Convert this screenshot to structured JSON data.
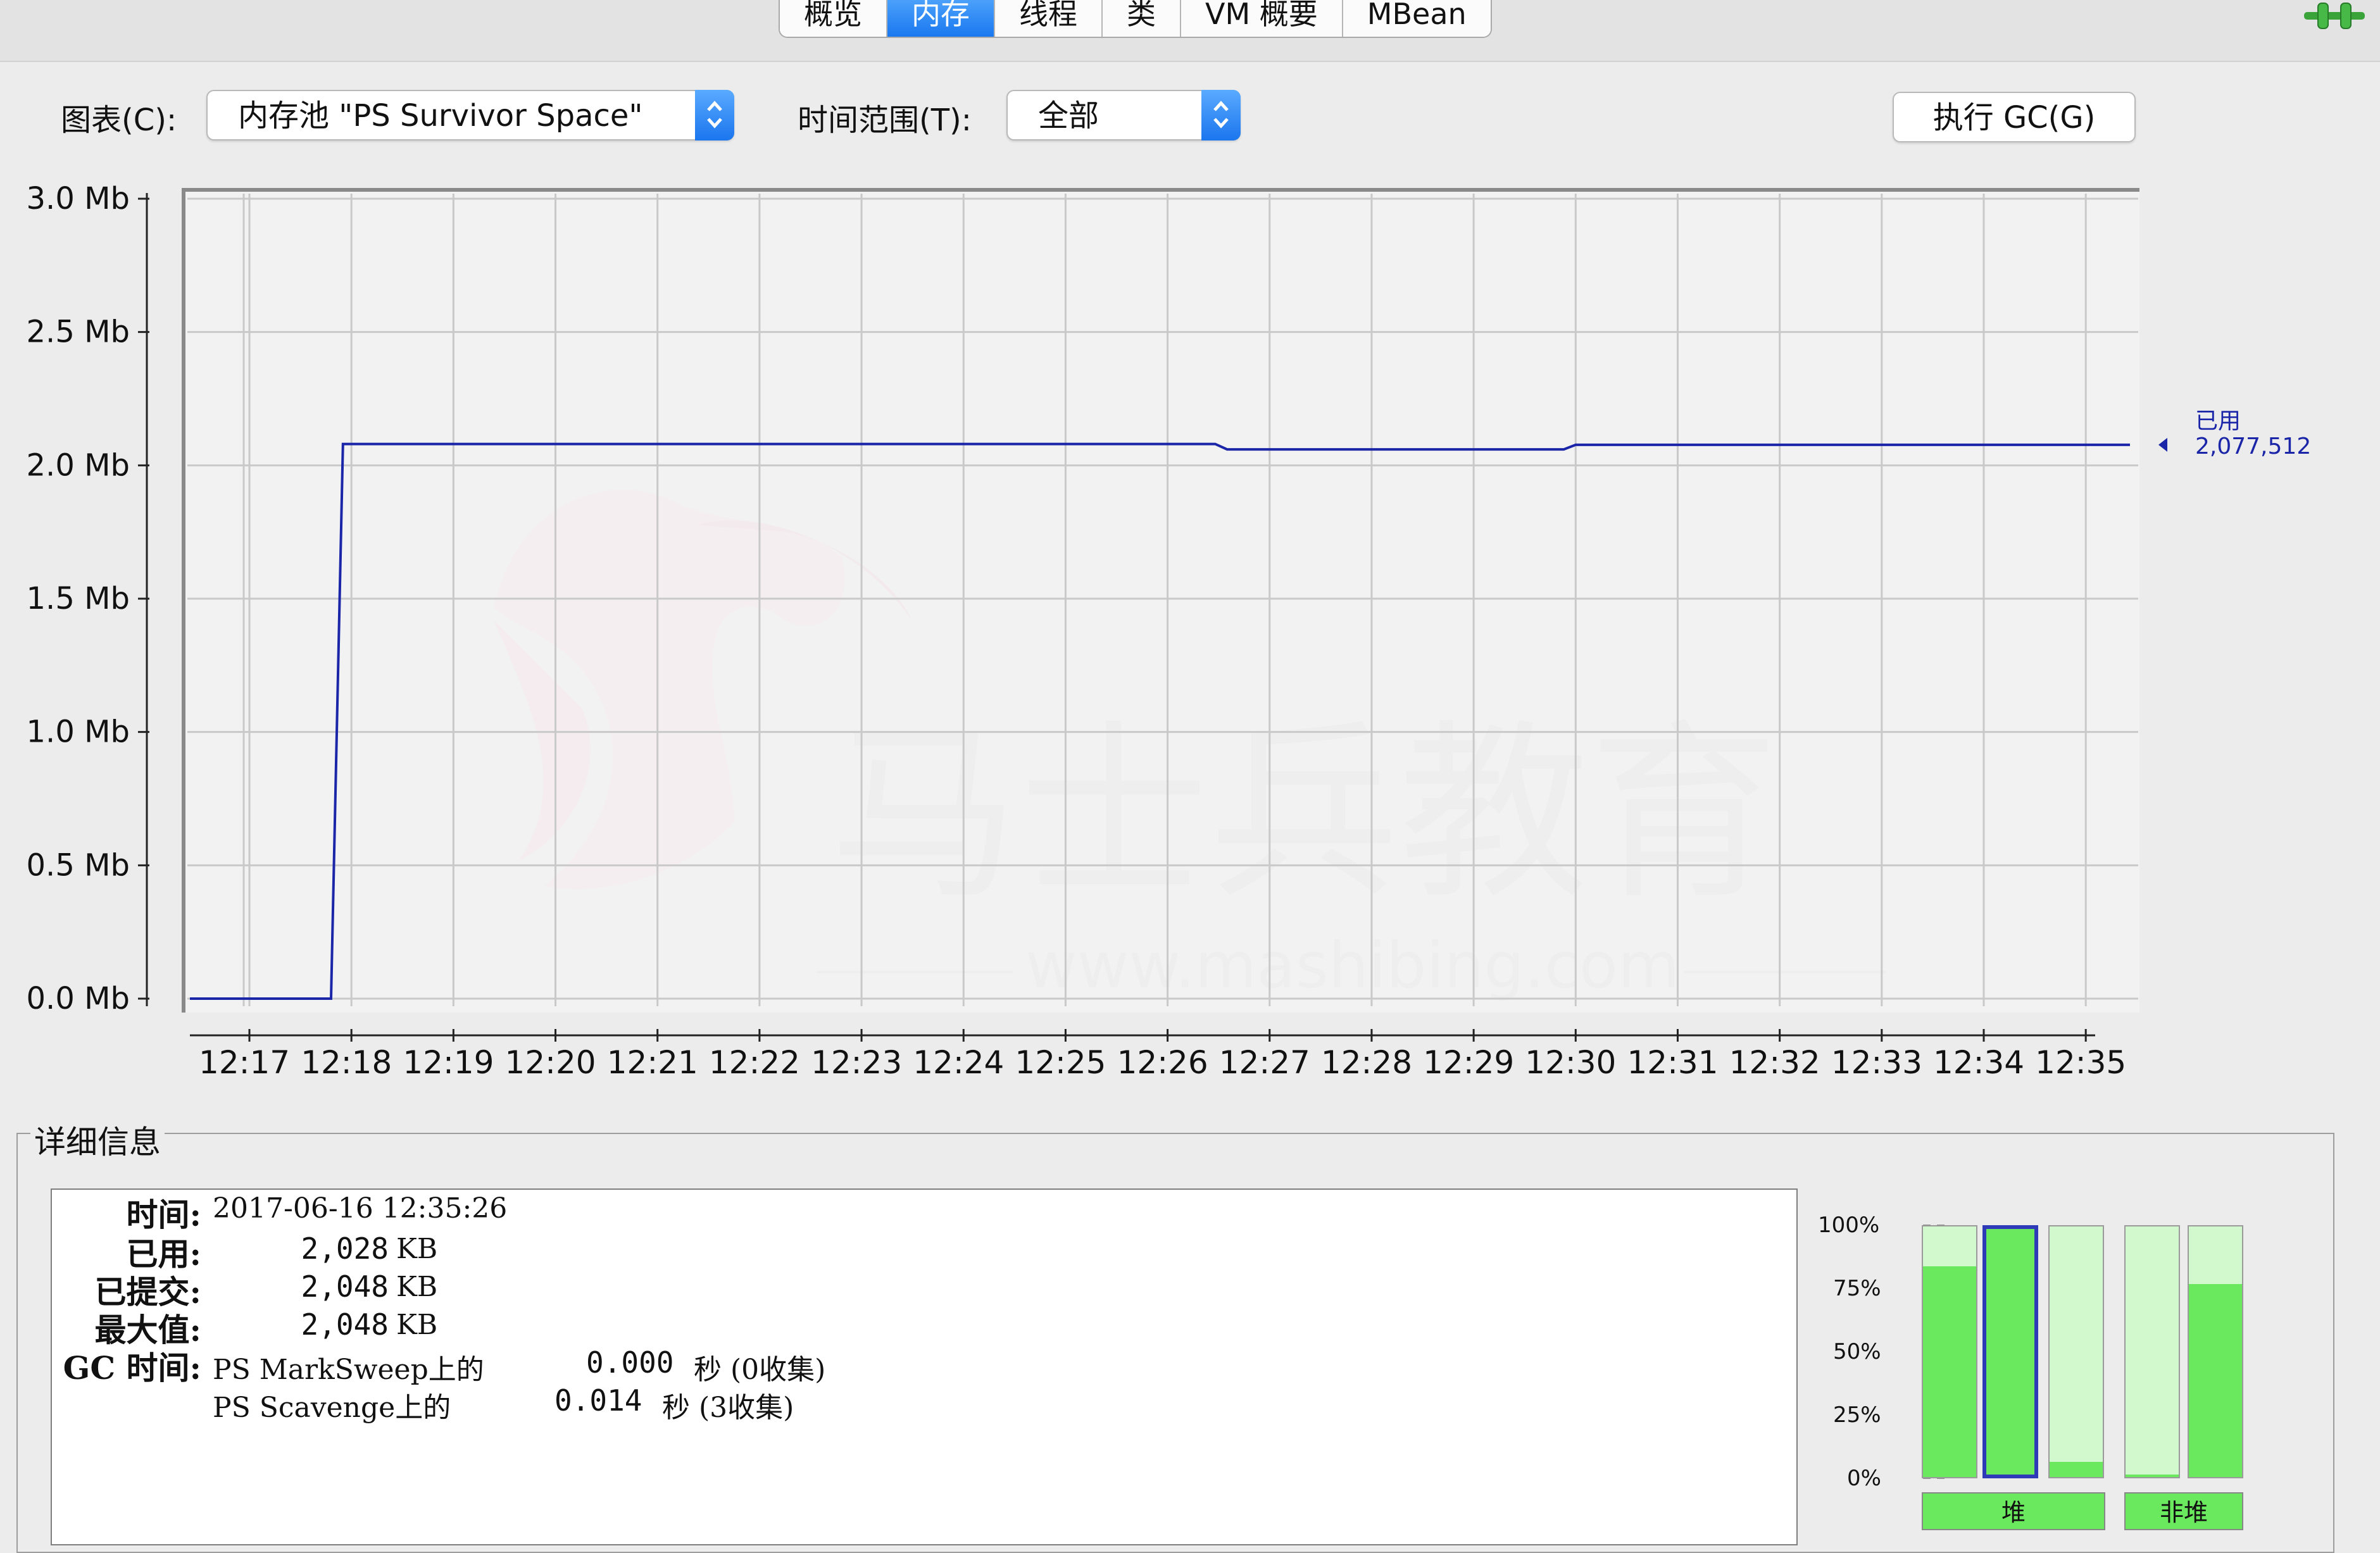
{
  "tabs": [
    {
      "label": "概览",
      "active": false
    },
    {
      "label": "内存",
      "active": true
    },
    {
      "label": "线程",
      "active": false
    },
    {
      "label": "类",
      "active": false
    },
    {
      "label": "VM 概要",
      "active": false
    },
    {
      "label": "MBean",
      "active": false
    }
  ],
  "controls": {
    "chart_label": "图表(C):",
    "chart_value": "内存池 \"PS Survivor Space\"",
    "range_label": "时间范围(T):",
    "range_value": "全部",
    "gc_button": "执行 GC(G)"
  },
  "chart_data": {
    "type": "line",
    "y_tick_labels": [
      "3.0 Mb",
      "2.5 Mb",
      "2.0 Mb",
      "1.5 Mb",
      "1.0 Mb",
      "0.5 Mb",
      "0.0 Mb"
    ],
    "y_ticks": [
      3.0,
      2.5,
      2.0,
      1.5,
      1.0,
      0.5,
      0.0
    ],
    "ylim": [
      0,
      3.0
    ],
    "x_tick_labels": [
      "12:17",
      "12:18",
      "12:19",
      "12:20",
      "12:21",
      "12:22",
      "12:23",
      "12:24",
      "12:25",
      "12:26",
      "12:27",
      "12:28",
      "12:29",
      "12:30",
      "12:31",
      "12:32",
      "12:33",
      "12:34",
      "12:35"
    ],
    "xlim": [
      "12:16:25",
      "12:35:26"
    ],
    "grid": true,
    "series": [
      {
        "name": "已用",
        "color": "#1a25a8",
        "points": [
          [
            "12:16:25",
            0.0
          ],
          [
            "12:17:48",
            0.0
          ],
          [
            "12:17:55",
            2.08
          ],
          [
            "12:26:28",
            2.08
          ],
          [
            "12:26:35",
            2.06
          ],
          [
            "12:29:53",
            2.06
          ],
          [
            "12:30:00",
            2.077
          ],
          [
            "12:35:26",
            2.077
          ]
        ]
      }
    ],
    "annotation": {
      "label": "已用",
      "value": "2,077,512"
    }
  },
  "details": {
    "title": "详细信息",
    "labels": {
      "time": "时间:",
      "used": "已用:",
      "committed": "已提交:",
      "max": "最大值:",
      "gc": "GC 时间:"
    },
    "time": "2017-06-16 12:35:26",
    "used": "2,028",
    "committed": "2,048",
    "max": "2,048",
    "unit": "KB",
    "gc1_name": "PS MarkSweep上的",
    "gc1_value": "0.000",
    "gc1_suffix": "秒 (0收集)",
    "gc2_name": "PS Scavenge上的",
    "gc2_value": "0.014",
    "gc2_suffix": "秒 (3收集)"
  },
  "gauge": {
    "percent_labels": [
      "100%",
      "75%",
      "50%",
      "25%",
      "0%"
    ],
    "heap_label": "堆",
    "nonheap_label": "非堆",
    "heap_levels": [
      0.84,
      1.0,
      0.06
    ],
    "nonheap_levels": [
      0.01,
      0.77
    ],
    "selected_index": 1,
    "fill_color": "#6be95e",
    "empty_color": "#d2f9cd"
  }
}
